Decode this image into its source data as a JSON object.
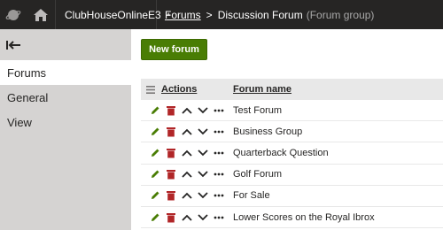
{
  "header": {
    "site_name": "ClubHouseOnlineE3",
    "site_caret": "▲",
    "breadcrumb": {
      "link": "Forums",
      "separator": ">",
      "current": "Discussion Forum",
      "current_type": "(Forum group)"
    }
  },
  "sidebar": {
    "items": [
      {
        "label": "Forums",
        "active": true
      },
      {
        "label": "General",
        "active": false
      },
      {
        "label": "View",
        "active": false
      }
    ]
  },
  "main": {
    "new_button_label": "New forum",
    "grid": {
      "columns": {
        "actions": "Actions",
        "name": "Forum name"
      },
      "rows": [
        {
          "name": "Test Forum"
        },
        {
          "name": "Business Group"
        },
        {
          "name": "Quarterback Question"
        },
        {
          "name": "Golf Forum"
        },
        {
          "name": "For Sale"
        },
        {
          "name": "Lower Scores on the Royal Ibrox"
        }
      ]
    }
  },
  "colors": {
    "topbar": "#262524",
    "sidebar": "#d5d3d2",
    "primary_button": "#497d04",
    "edit_icon": "#497d04",
    "delete_icon": "#b12628",
    "grid_header": "#e8e8e8"
  },
  "icons": {
    "logo": "planet-logo-icon",
    "home": "home-icon",
    "back": "back-arrow-icon",
    "grid_menu": "hamburger-icon",
    "edit": "pencil-icon",
    "delete": "trash-icon",
    "move_up": "chevron-up-icon",
    "move_down": "chevron-down-icon",
    "more": "ellipsis-icon"
  }
}
